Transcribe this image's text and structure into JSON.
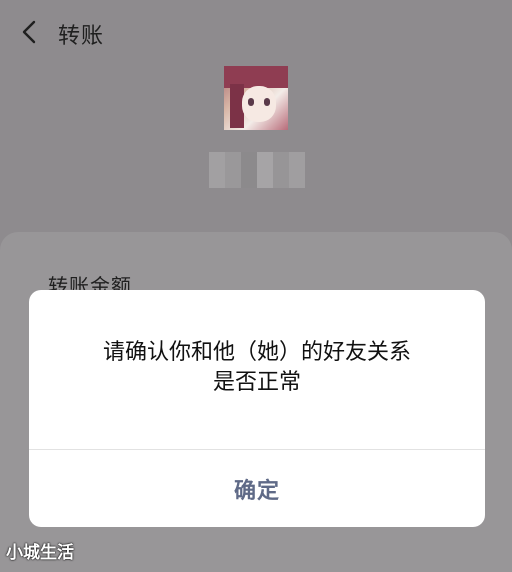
{
  "header": {
    "back_icon": "chevron-left-icon",
    "title": "转账"
  },
  "recipient": {
    "avatar_icon": "anime-avatar"
  },
  "transfer": {
    "amount_label": "转账金额"
  },
  "dialog": {
    "message_line1": "请确认你和他（她）的好友关系",
    "message_line2": "是否正常",
    "confirm_label": "确定"
  },
  "watermark": "小城生活",
  "colors": {
    "overlay_bg": "#8e8b8e",
    "dialog_bg": "#ffffff",
    "confirm_text": "#5f6a87"
  }
}
